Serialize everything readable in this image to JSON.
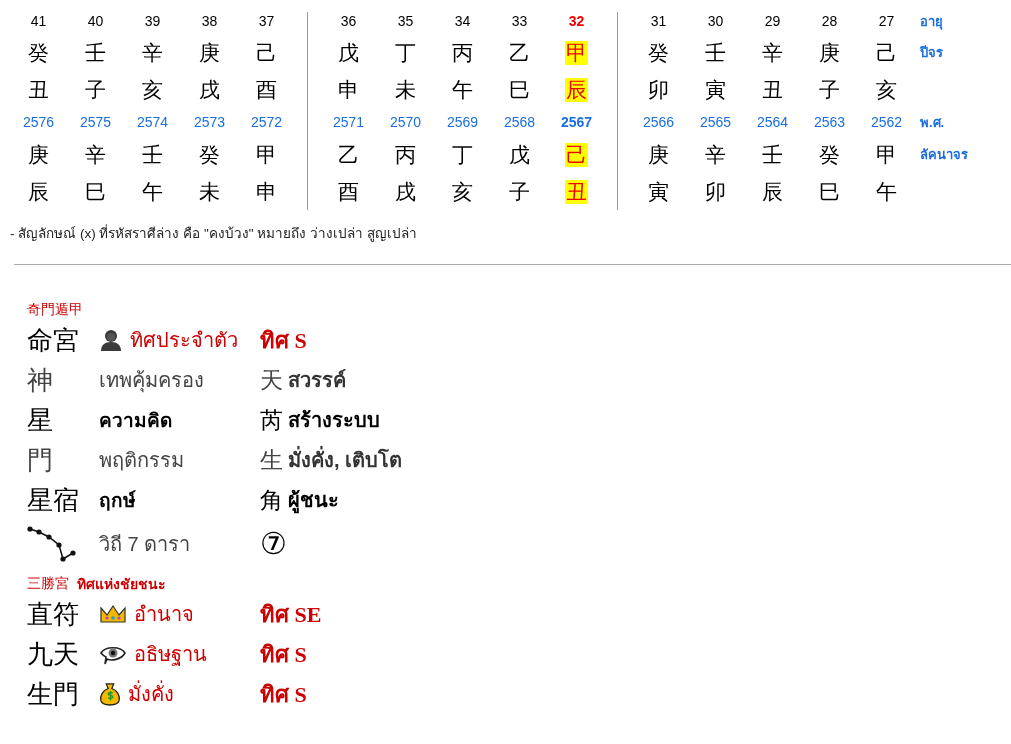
{
  "calendar": {
    "groups": [
      {
        "columns": [
          {
            "age": "41",
            "year_stem": "癸",
            "year_branch": "丑",
            "be_year": "2576",
            "lagna_stem": "庚",
            "lagna_branch": "辰",
            "selected": false
          },
          {
            "age": "40",
            "year_stem": "壬",
            "year_branch": "子",
            "be_year": "2575",
            "lagna_stem": "辛",
            "lagna_branch": "巳",
            "selected": false
          },
          {
            "age": "39",
            "year_stem": "辛",
            "year_branch": "亥",
            "be_year": "2574",
            "lagna_stem": "壬",
            "lagna_branch": "午",
            "selected": false
          },
          {
            "age": "38",
            "year_stem": "庚",
            "year_branch": "戌",
            "be_year": "2573",
            "lagna_stem": "癸",
            "lagna_branch": "未",
            "selected": false
          },
          {
            "age": "37",
            "year_stem": "己",
            "year_branch": "酉",
            "be_year": "2572",
            "lagna_stem": "甲",
            "lagna_branch": "申",
            "selected": false
          }
        ]
      },
      {
        "columns": [
          {
            "age": "36",
            "year_stem": "戊",
            "year_branch": "申",
            "be_year": "2571",
            "lagna_stem": "乙",
            "lagna_branch": "酉",
            "selected": false
          },
          {
            "age": "35",
            "year_stem": "丁",
            "year_branch": "未",
            "be_year": "2570",
            "lagna_stem": "丙",
            "lagna_branch": "戌",
            "selected": false
          },
          {
            "age": "34",
            "year_stem": "丙",
            "year_branch": "午",
            "be_year": "2569",
            "lagna_stem": "丁",
            "lagna_branch": "亥",
            "selected": false
          },
          {
            "age": "33",
            "year_stem": "乙",
            "year_branch": "巳",
            "be_year": "2568",
            "lagna_stem": "戊",
            "lagna_branch": "子",
            "selected": false
          },
          {
            "age": "32",
            "year_stem": "甲",
            "year_branch": "辰",
            "be_year": "2567",
            "lagna_stem": "己",
            "lagna_branch": "丑",
            "selected": true
          }
        ]
      },
      {
        "columns": [
          {
            "age": "31",
            "year_stem": "癸",
            "year_branch": "卯",
            "be_year": "2566",
            "lagna_stem": "庚",
            "lagna_branch": "寅",
            "selected": false
          },
          {
            "age": "30",
            "year_stem": "壬",
            "year_branch": "寅",
            "be_year": "2565",
            "lagna_stem": "辛",
            "lagna_branch": "卯",
            "selected": false
          },
          {
            "age": "29",
            "year_stem": "辛",
            "year_branch": "丑",
            "be_year": "2564",
            "lagna_stem": "壬",
            "lagna_branch": "辰",
            "selected": false
          },
          {
            "age": "28",
            "year_stem": "庚",
            "year_branch": "子",
            "be_year": "2563",
            "lagna_stem": "癸",
            "lagna_branch": "巳",
            "selected": false
          },
          {
            "age": "27",
            "year_stem": "己",
            "year_branch": "亥",
            "be_year": "2562",
            "lagna_stem": "甲",
            "lagna_branch": "午",
            "selected": false
          }
        ]
      }
    ],
    "age_label": "อายุ",
    "year_label": "ปีจร",
    "be_label": "พ.ศ.",
    "lagna_label": "ลัคนาจร",
    "note": "- สัญลักษณ์ (x) ที่รหัสราศีล่าง คือ \"คงบ้วง\" หมายถึง ว่างเปล่า สูญเปล่า"
  },
  "qimen": {
    "heading": "奇門遁甲",
    "rows": [
      {
        "kind": "main",
        "label": "命宮",
        "text": "ทิศประจำตัว",
        "direction": "ทิศ S"
      },
      {
        "kind": "attr",
        "emphasized": false,
        "label": "神",
        "text": "เทพคุ้มครอง",
        "symbol": "天",
        "value": "สวรรค์"
      },
      {
        "kind": "attr",
        "emphasized": true,
        "label": "星",
        "text": "ความคิด",
        "symbol": "芮",
        "value": "สร้างระบบ"
      },
      {
        "kind": "attr",
        "emphasized": false,
        "label": "門",
        "text": "พฤติกรรม",
        "symbol": "生",
        "value": "มั่งคั่ง, เติบโต"
      },
      {
        "kind": "attr",
        "emphasized": true,
        "label": "星宿",
        "text": "ฤกษ์",
        "symbol": "角",
        "value": "ผู้ชนะ"
      },
      {
        "kind": "path",
        "text": "วิถี 7 ดารา",
        "badge": "⑦"
      }
    ]
  },
  "victory": {
    "heading": "三勝宮",
    "subheading": "ทิศแห่งชัยชนะ",
    "rows": [
      {
        "label": "直符",
        "text": "อำนาจ",
        "direction": "ทิศ SE"
      },
      {
        "label": "九天",
        "text": "อธิษฐาน",
        "direction": "ทิศ S"
      },
      {
        "label": "生門",
        "text": "มั่งคั่ง",
        "direction": "ทิศ S"
      }
    ]
  }
}
